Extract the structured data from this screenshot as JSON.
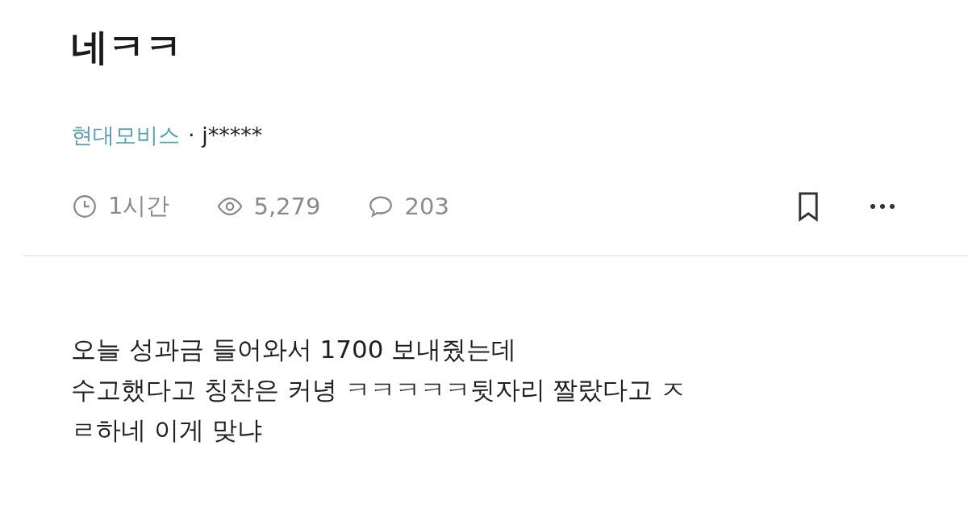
{
  "post": {
    "title": "네ㅋㅋ",
    "company": "현대모비스",
    "author": "· j*****",
    "stats": [
      {
        "kind": "time",
        "text": "1시간"
      },
      {
        "kind": "views",
        "text": "5,279"
      },
      {
        "kind": "comments",
        "text": "203"
      }
    ],
    "bookmarked": false,
    "body": [
      "오늘 성과금 들어와서 1700 보내줬는데",
      "수고했다고 칭찬은 커녕 ㅋㅋㅋㅋㅋ뒷자리 짤랐다고 ㅈ",
      "ㄹ하네 이게 맞냐"
    ]
  }
}
